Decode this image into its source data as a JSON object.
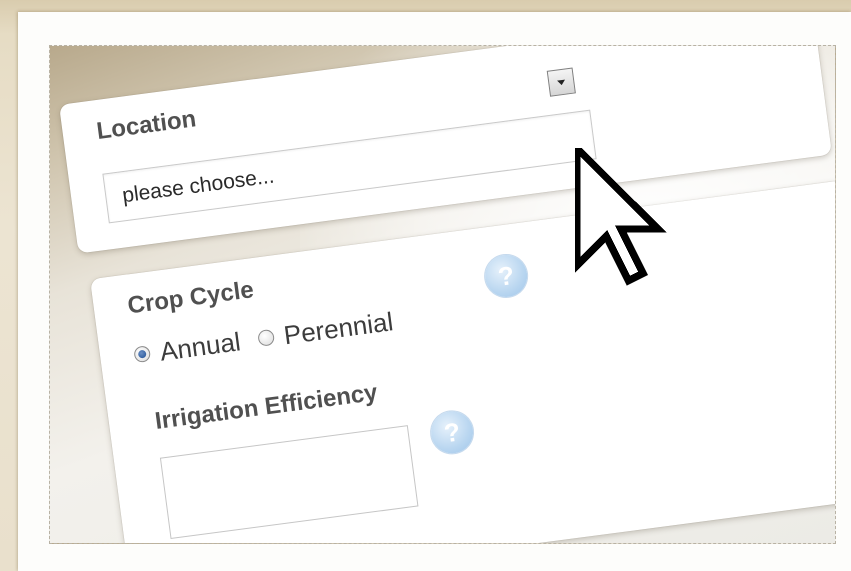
{
  "form": {
    "location": {
      "label": "Location",
      "select_value": "please choose..."
    },
    "crop_cycle": {
      "label": "Crop Cycle",
      "options": [
        {
          "label": "Annual",
          "checked": true
        },
        {
          "label": "Perennial",
          "checked": false
        }
      ],
      "help_glyph": "?"
    },
    "irrigation_efficiency": {
      "label": "Irrigation Efficiency",
      "value": "",
      "help_glyph": "?"
    }
  },
  "icons": {
    "select_arrow": "chevron-down-icon",
    "help": "help-icon",
    "cursor": "mouse-pointer-icon"
  },
  "colors": {
    "label_text": "#505050",
    "radio_selected": "#1f4f94",
    "help_icon": "#b9d6f0",
    "background": "#e6dcc4"
  }
}
